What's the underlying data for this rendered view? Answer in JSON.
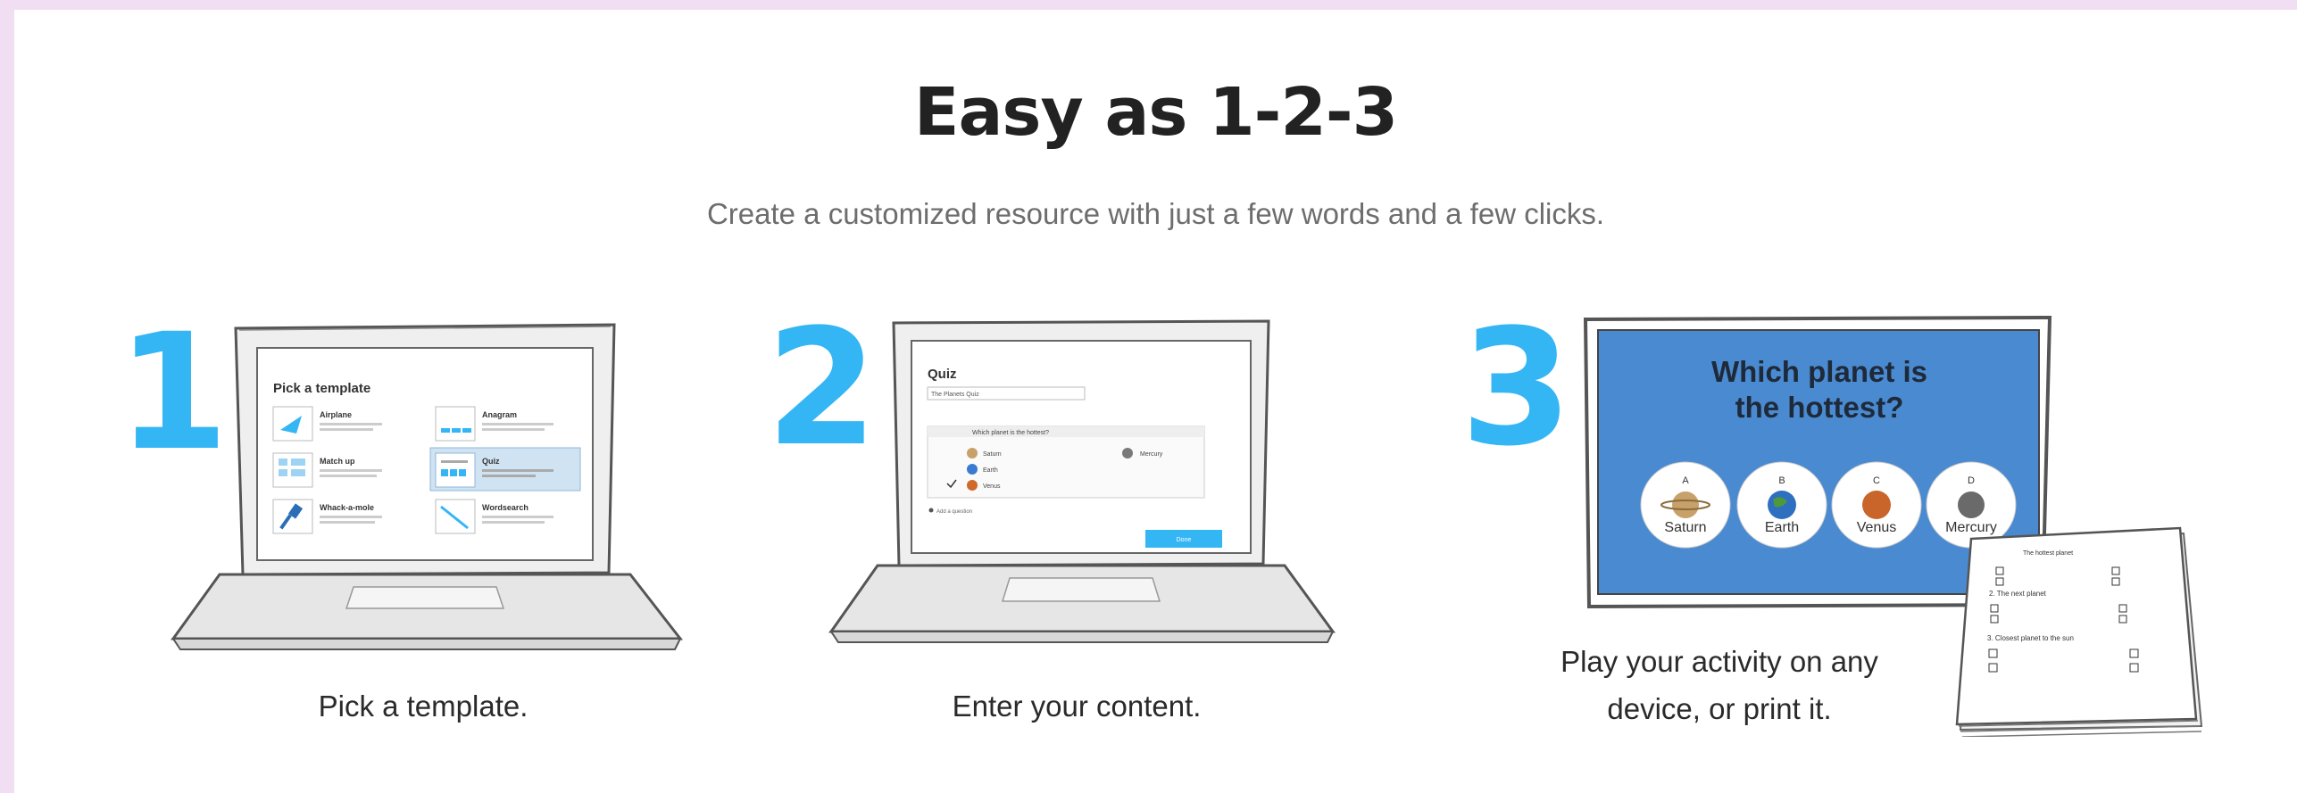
{
  "header": {
    "title": "Easy as 1-2-3",
    "subtitle": "Create a customized resource with just a few words and a few clicks."
  },
  "steps": [
    {
      "number": "1",
      "caption": "Pick a template."
    },
    {
      "number": "2",
      "caption": "Enter your content."
    },
    {
      "number": "3",
      "caption": "Play your activity on any device, or print it."
    }
  ],
  "screen1": {
    "heading": "Pick a template",
    "templates": [
      {
        "name": "Airplane",
        "icon": "airplane-icon"
      },
      {
        "name": "Anagram",
        "icon": "anagram-icon"
      },
      {
        "name": "Match up",
        "icon": "match-up-icon"
      },
      {
        "name": "Quiz",
        "icon": "quiz-icon"
      },
      {
        "name": "Whack-a-mole",
        "icon": "hammer-icon"
      },
      {
        "name": "Wordsearch",
        "icon": "wordsearch-icon"
      }
    ]
  },
  "screen2": {
    "heading": "Quiz",
    "title_value": "The Planets Quiz",
    "question": "Which planet is the hottest?",
    "answers": [
      "Saturn",
      "Mercury",
      "Earth",
      "Venus"
    ],
    "add_question": "Add a question",
    "done_button": "Done"
  },
  "screen3": {
    "question_line1": "Which planet is",
    "question_line2": "the hottest?",
    "options": [
      {
        "letter": "A",
        "name": "Saturn"
      },
      {
        "letter": "B",
        "name": "Earth"
      },
      {
        "letter": "C",
        "name": "Venus"
      },
      {
        "letter": "D",
        "name": "Mercury"
      }
    ],
    "worksheet": {
      "q1": "The hottest planet",
      "q2": "2. The next planet",
      "q3": "3. Closest planet to the sun"
    }
  },
  "colors": {
    "background": "#f1def3",
    "accent": "#35b6f4",
    "screen_blue": "#4a8ad0",
    "done_button": "#35b6f4"
  }
}
